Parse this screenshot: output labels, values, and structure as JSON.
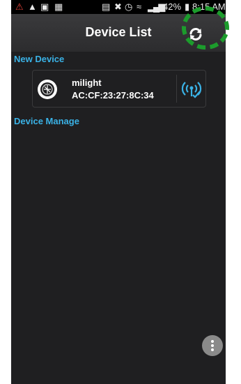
{
  "status_bar": {
    "battery_percent": "42%",
    "time": "8:15 AM"
  },
  "app_bar": {
    "title": "Device List"
  },
  "sections": {
    "new_device": "New Device",
    "device_manage": "Device Manage"
  },
  "devices": [
    {
      "name": "milight",
      "mac": "AC:CF:23:27:8C:34"
    }
  ],
  "colors": {
    "accent": "#3ab2e6",
    "background": "#1f1f21",
    "highlight": "#1c9c2c"
  },
  "icons": {
    "refresh": "refresh-icon",
    "device": "device-icon",
    "connect": "wifi-connect-icon",
    "menu": "more-vert-icon"
  }
}
